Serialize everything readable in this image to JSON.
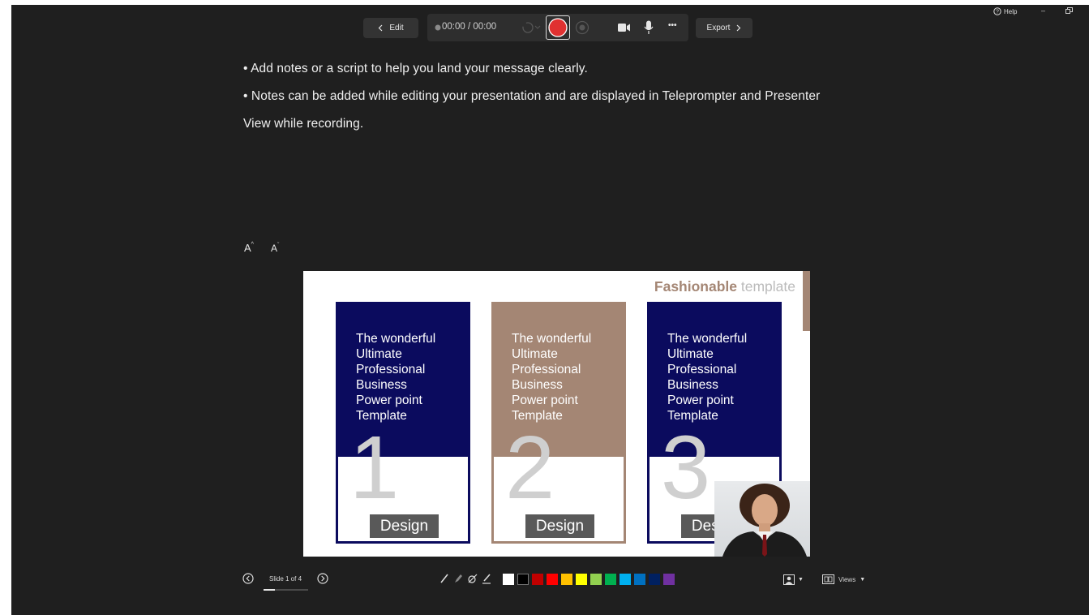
{
  "window": {
    "help_label": "Help",
    "minimize": "–"
  },
  "toolbar": {
    "edit_label": "Edit",
    "timer": "00:00 / 00:00",
    "export_label": "Export",
    "more_label": "•••"
  },
  "notes": {
    "line1": "• Add notes or a script to help you land your message clearly.",
    "line2": "• Notes can be added while editing your presentation and are displayed in Teleprompter and Presenter",
    "line3": "View while recording."
  },
  "font_controls": {
    "increase": "A",
    "decrease": "A"
  },
  "slide": {
    "title_bold": "Fashionable",
    "title_rest": " template",
    "cards": [
      {
        "lines": [
          "The wonderful",
          "Ultimate",
          "Professional",
          "Business",
          "Power point",
          "Template"
        ],
        "number": "1",
        "button": "Design",
        "color": "#0b0b5e"
      },
      {
        "lines": [
          "The wonderful",
          "Ultimate",
          "Professional",
          "Business",
          "Power point",
          "Template"
        ],
        "number": "2",
        "button": "Design",
        "color": "#a48674"
      },
      {
        "lines": [
          "The wonderful",
          "Ultimate",
          "Professional",
          "Business",
          "Power point",
          "Template"
        ],
        "number": "3",
        "button": "Design",
        "color": "#0b0b5e"
      }
    ],
    "accent_color": "#a48674"
  },
  "footer": {
    "slide_counter": "Slide 1 of 4",
    "views_label": "Views",
    "colors": [
      "#ffffff",
      "#000000",
      "#c00000",
      "#ff0000",
      "#ffc000",
      "#ffff00",
      "#92d050",
      "#00b050",
      "#00b0f0",
      "#0070c0",
      "#002060",
      "#7030a0"
    ]
  },
  "colors": {
    "record": "#e03131",
    "background": "#1f1f1f"
  }
}
